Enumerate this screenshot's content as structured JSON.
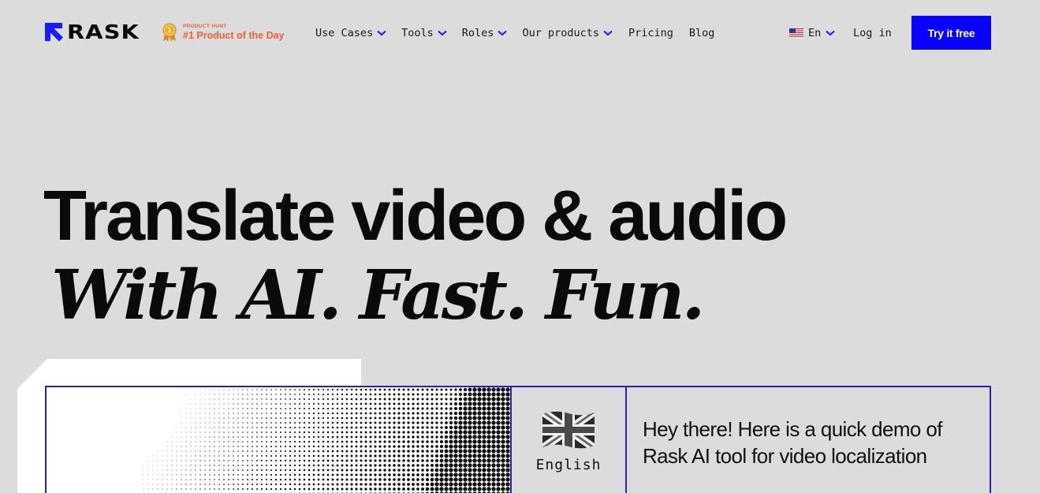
{
  "header": {
    "logo_text": "RASK",
    "product_hunt": {
      "label_small": "PRODUCT HUNT",
      "label_big": "#1 Product of the Day",
      "icon": "medal-icon"
    },
    "nav": [
      {
        "label": "Use Cases",
        "has_dropdown": true
      },
      {
        "label": "Tools",
        "has_dropdown": true
      },
      {
        "label": "Roles",
        "has_dropdown": true
      },
      {
        "label": "Our products",
        "has_dropdown": true
      },
      {
        "label": "Pricing",
        "has_dropdown": false
      },
      {
        "label": "Blog",
        "has_dropdown": false
      }
    ],
    "language": {
      "label": "En",
      "flag": "us-flag-icon"
    },
    "login_label": "Log in",
    "cta_label": "Try it free"
  },
  "hero": {
    "line1": "Translate video & audio",
    "line2": "With AI. Fast. Fun."
  },
  "demo": {
    "language_label": "English",
    "flag": "uk-flag-icon",
    "caption": "Hey there! Here is a quick demo of Rask AI tool for video localization"
  },
  "colors": {
    "background": "#dcdcdd",
    "accent": "#0a00ff",
    "border": "#2b1fbf",
    "product_hunt": "#e8603c",
    "text": "#0a0a0a"
  }
}
